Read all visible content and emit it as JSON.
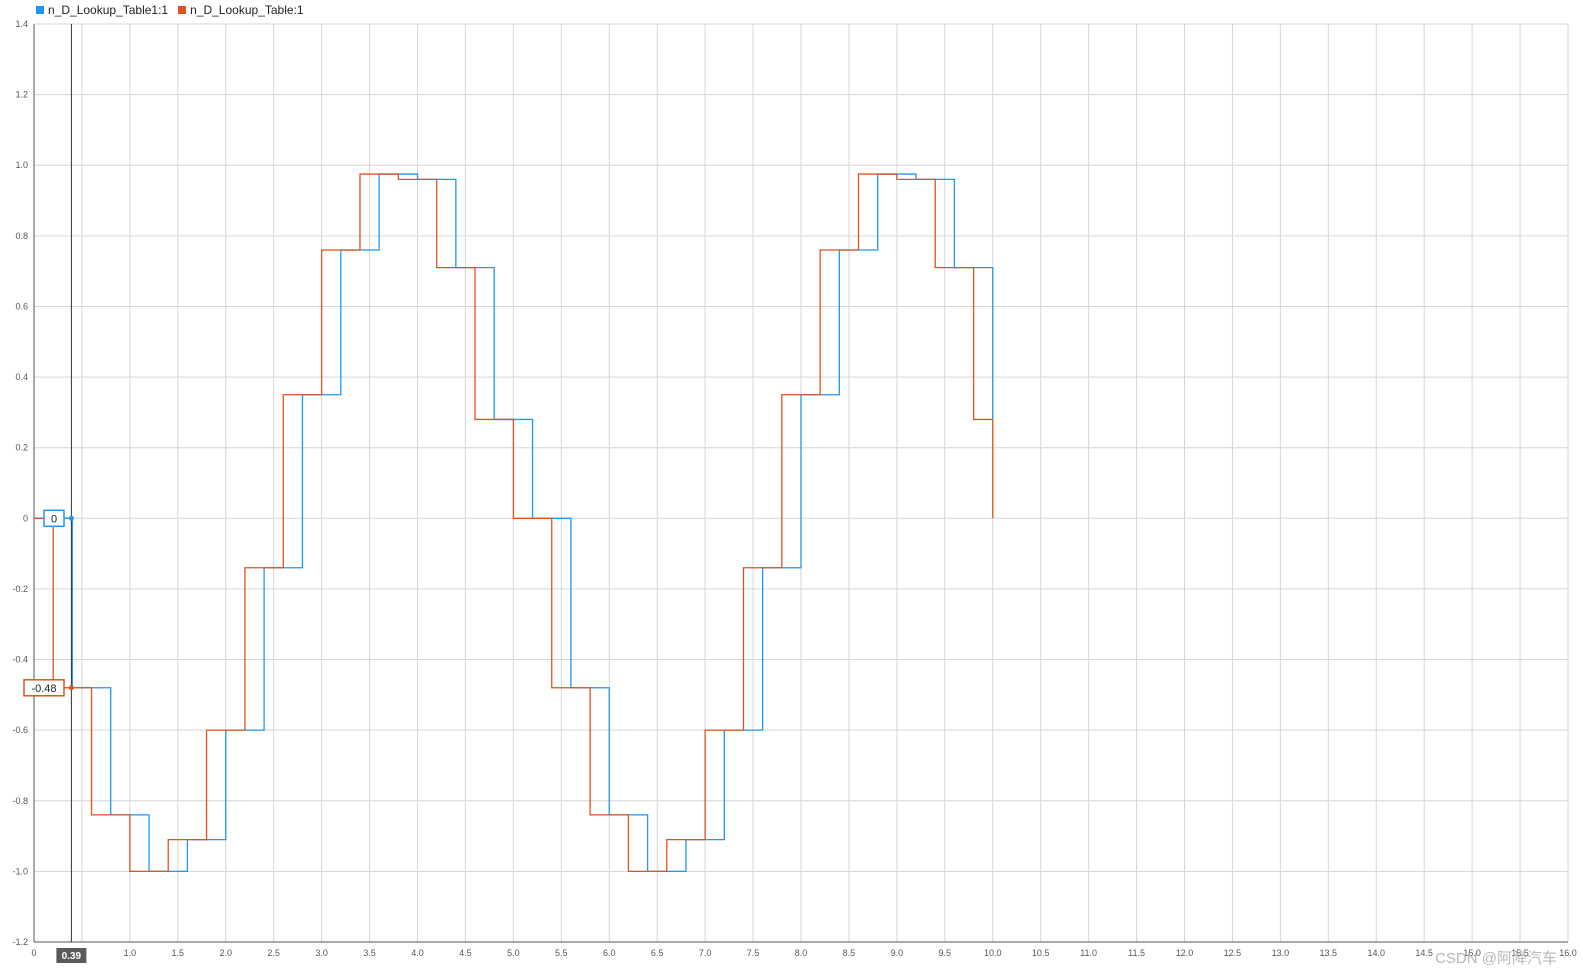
{
  "legend": [
    {
      "name": "n_D_Lookup_Table1:1",
      "color": "#2196f3"
    },
    {
      "name": "n_D_Lookup_Table:1",
      "color": "#e0521f"
    }
  ],
  "watermark": "CSDN @阿降汽车",
  "cursor": {
    "x_label": "0.39",
    "blue_value": "0",
    "red_value": "-0.48"
  },
  "chart_data": {
    "type": "line",
    "xlim": [
      0,
      16
    ],
    "ylim": [
      -1.2,
      1.4
    ],
    "x_ticks": [
      "0",
      "0.39",
      "1.0",
      "1.5",
      "2.0",
      "2.5",
      "3.0",
      "3.5",
      "4.0",
      "4.5",
      "5.0",
      "5.5",
      "6.0",
      "6.5",
      "7.0",
      "7.5",
      "8.0",
      "8.5",
      "9.0",
      "9.5",
      "10.0",
      "10.5",
      "11.0",
      "11.5",
      "12.0",
      "12.5",
      "13.0",
      "13.5",
      "14.0",
      "14.5",
      "15.0",
      "15.5",
      "16.0"
    ],
    "y_ticks": [
      "1.4",
      "1.2",
      "1.0",
      "0.8",
      "0.6",
      "0.4",
      "0.2",
      "0",
      "-0.2",
      "-0.4",
      "-0.6",
      "-0.8",
      "-1.0",
      "-1.2"
    ],
    "grid": true,
    "series": [
      {
        "name": "n_D_Lookup_Table1:1",
        "color": "#2196f3",
        "x": [
          0,
          0.4,
          0.8,
          1.2,
          1.6,
          2.0,
          2.4,
          2.8,
          3.2,
          3.6,
          4.0,
          4.4,
          4.8,
          5.2,
          5.6,
          6.0,
          6.4,
          6.8,
          7.2,
          7.6,
          8.0,
          8.4,
          8.8,
          9.2,
          9.6,
          10.0
        ],
        "y": [
          0,
          -0.48,
          -0.84,
          -1.0,
          -0.91,
          -0.6,
          -0.14,
          0.35,
          0.76,
          0.975,
          0.96,
          0.71,
          0.28,
          0,
          -0.48,
          -0.84,
          -1.0,
          -0.91,
          -0.6,
          -0.14,
          0.35,
          0.76,
          0.975,
          0.96,
          0.71,
          0.28
        ]
      },
      {
        "name": "n_D_Lookup_Table:1",
        "color": "#e0521f",
        "x": [
          0,
          0.2,
          0.6,
          1.0,
          1.4,
          1.8,
          2.2,
          2.6,
          3.0,
          3.4,
          3.8,
          4.2,
          4.6,
          5.0,
          5.4,
          5.8,
          6.2,
          6.6,
          7.0,
          7.4,
          7.8,
          8.2,
          8.6,
          9.0,
          9.4,
          9.8,
          10.0
        ],
        "y": [
          0,
          -0.48,
          -0.84,
          -1.0,
          -0.91,
          -0.6,
          -0.14,
          0.35,
          0.76,
          0.975,
          0.96,
          0.71,
          0.28,
          0,
          -0.48,
          -0.84,
          -1.0,
          -0.91,
          -0.6,
          -0.14,
          0.35,
          0.76,
          0.975,
          0.96,
          0.71,
          0.28,
          0
        ]
      }
    ]
  }
}
